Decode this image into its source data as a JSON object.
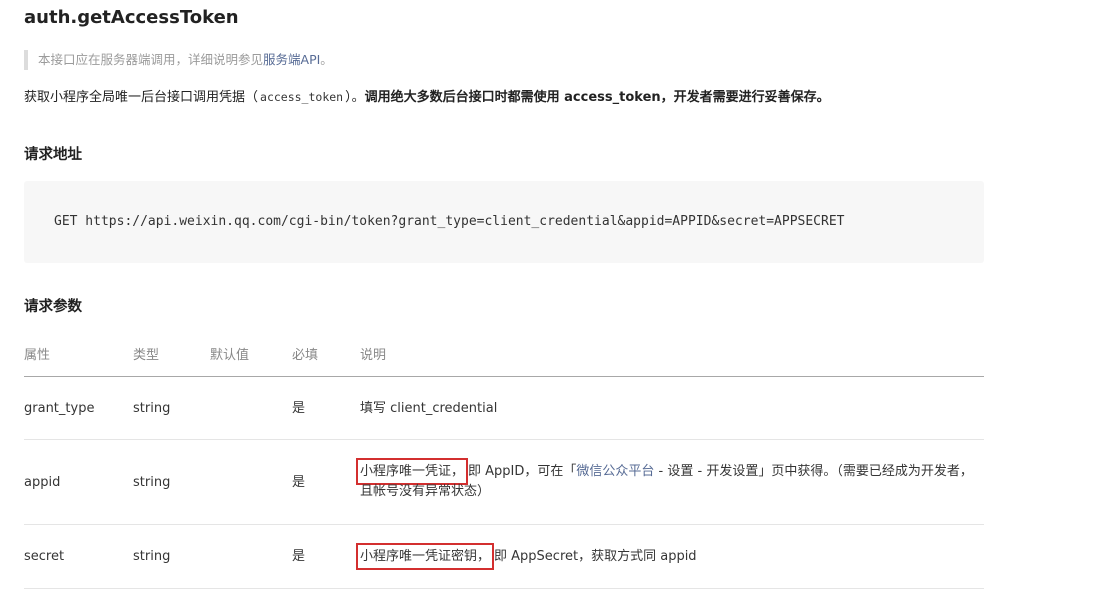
{
  "title": "auth.getAccessToken",
  "notice": {
    "text": "本接口应在服务器端调用，详细说明参见",
    "link": "服务端API",
    "suffix": "。"
  },
  "description": {
    "pre": "获取小程序全局唯一后台接口调用凭据（",
    "code": "access_token",
    "mid": "）。",
    "bold": "调用绝大多数后台接口时都需使用 access_token，开发者需要进行妥善保存。"
  },
  "request_url": {
    "heading": "请求地址",
    "code": "GET https://api.weixin.qq.com/cgi-bin/token?grant_type=client_credential&appid=APPID&secret=APPSECRET"
  },
  "params": {
    "heading": "请求参数",
    "headers": [
      "属性",
      "类型",
      "默认值",
      "必填",
      "说明"
    ],
    "rows": [
      {
        "name": "grant_type",
        "type": "string",
        "default": "",
        "required": "是",
        "desc": "填写 client_credential"
      },
      {
        "name": "appid",
        "type": "string",
        "default": "",
        "required": "是",
        "desc_highlight": "小程序唯一凭证，",
        "desc_pre": "即 AppID，可在「",
        "desc_link": "微信公众平台",
        "desc_post": " - 设置 - 开发设置」页中获得。（需要已经成为开发者，且帐号没有异常状态）"
      },
      {
        "name": "secret",
        "type": "string",
        "default": "",
        "required": "是",
        "desc_highlight": "小程序唯一凭证密钥，",
        "desc_post": "即 AppSecret，获取方式同 appid"
      }
    ]
  },
  "colors": {
    "link": "#576b95",
    "highlight_box": "#d32f2f"
  }
}
